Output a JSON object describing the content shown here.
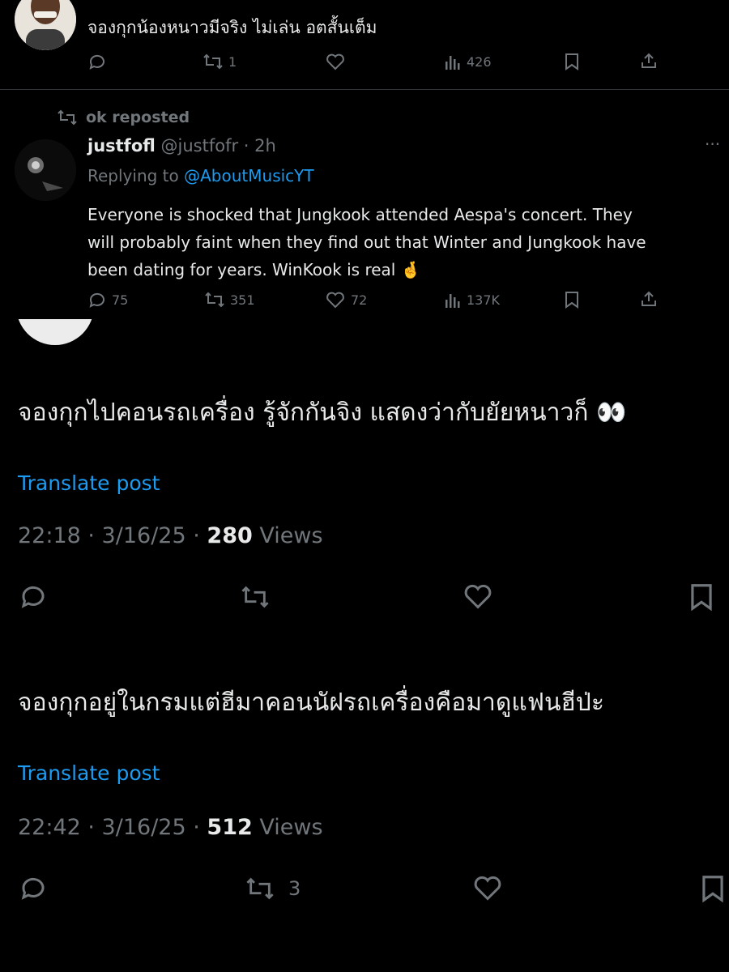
{
  "colors": {
    "background": "#000000",
    "text": "#e7e9ea",
    "muted": "#71767b",
    "link": "#1d9bf0",
    "divider": "#2f3336"
  },
  "top_reply": {
    "text": "จองกุกน้องหนาวมีจริง ไม่เล่น อตสั้นเต็ม",
    "reposts": "1",
    "views": "426",
    "icons": [
      "reply-icon",
      "repost-icon",
      "like-icon",
      "views-icon",
      "bookmark-icon",
      "share-icon"
    ]
  },
  "quoted_post": {
    "repost_label": "ok reposted",
    "author_name": "justfofl",
    "author_handle": "@justfofr",
    "time": "· 2h",
    "replying_prefix": "Replying to",
    "replying_to": "@AboutMusicYT",
    "body_line1": "Everyone is shocked that Jungkook attended Aespa's concert. They",
    "body_line2": "will probably faint when they find out that Winter and Jungkook have",
    "body_line3": "been dating for years. WinKook is real",
    "emoji": "🤞",
    "replies": "75",
    "reposts": "351",
    "likes": "72",
    "views": "137K",
    "more_label": "···"
  },
  "post1": {
    "text": "จองกุกไปคอนรถเครื่อง รู้จักกันจิง แสดงว่ากับยัยหนาวก็ 👀",
    "translate": "Translate post",
    "timestamp": "22:18 · 3/16/25 ·",
    "views_count": "280",
    "views_label": "Views"
  },
  "post2": {
    "text": "จองกุกอยู่ในกรมแต่ฮีมาคอนนัฝรถเครื่องคือมาดูแฟนฮีป่ะ",
    "translate": "Translate post",
    "timestamp": "22:42 · 3/16/25 ·",
    "views_count": "512",
    "views_label": "Views",
    "reposts": "3"
  }
}
